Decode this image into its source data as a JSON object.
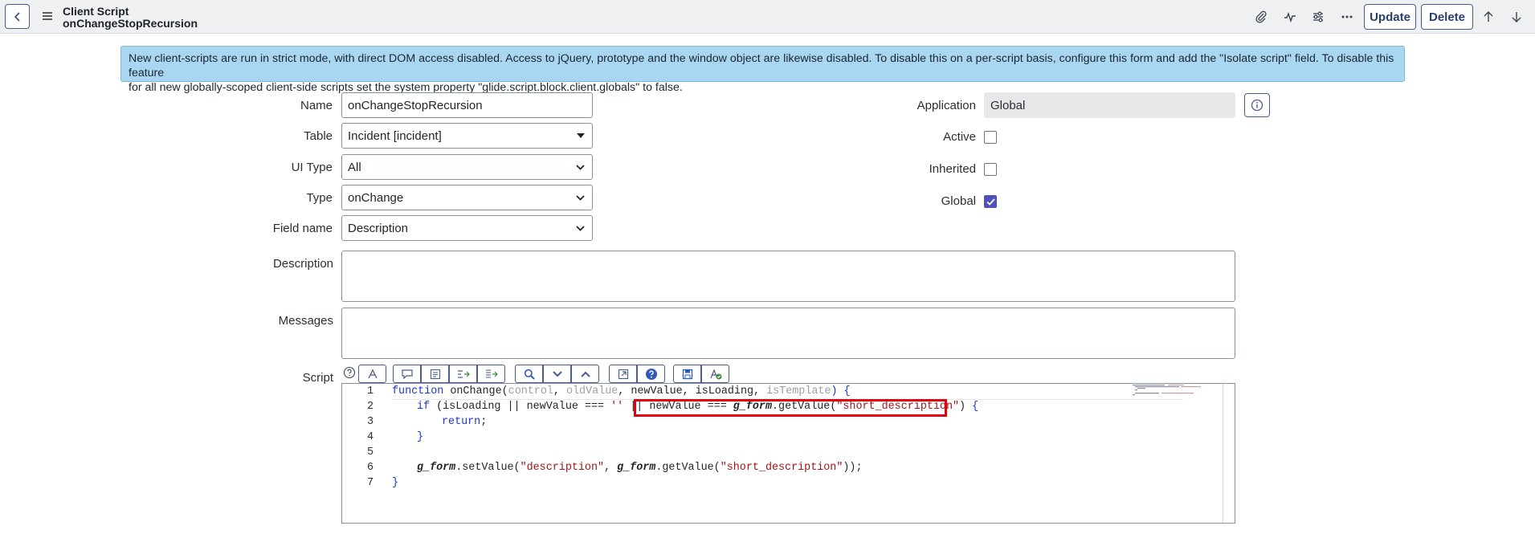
{
  "header": {
    "record_type": "Client Script",
    "record_name": "onChangeStopRecursion",
    "update_label": "Update",
    "delete_label": "Delete"
  },
  "banner": {
    "line1": "New client-scripts are run in strict mode, with direct DOM access disabled. Access to jQuery, prototype and the window object are likewise disabled. To disable this on a per-script basis, configure this form and add the \"Isolate script\" field. To disable this feature",
    "line2": "for all new globally-scoped client-side scripts set the system property \"glide.script.block.client.globals\" to false."
  },
  "form": {
    "name": {
      "label": "Name",
      "value": "onChangeStopRecursion"
    },
    "table": {
      "label": "Table",
      "value": "Incident [incident]"
    },
    "ui_type": {
      "label": "UI Type",
      "value": "All"
    },
    "type": {
      "label": "Type",
      "value": "onChange"
    },
    "field_name": {
      "label": "Field name",
      "value": "Description"
    },
    "application": {
      "label": "Application",
      "value": "Global"
    },
    "active": {
      "label": "Active",
      "checked": false
    },
    "inherited": {
      "label": "Inherited",
      "checked": false
    },
    "global": {
      "label": "Global",
      "checked": true
    },
    "description": {
      "label": "Description",
      "value": ""
    },
    "messages": {
      "label": "Messages",
      "value": ""
    },
    "script": {
      "label": "Script"
    }
  },
  "editor": {
    "line_numbers": [
      "1",
      "2",
      "3",
      "4",
      "5",
      "6",
      "7"
    ],
    "lines": {
      "l1": {
        "kw": "function",
        "fn": " onChange(",
        "p1": "control",
        "c1": ", ",
        "p2": "oldValue",
        "c2": ", newValue, isLoading, ",
        "p3": "isTemplate",
        "end": ") {"
      },
      "l2": {
        "kw": "if",
        "a": " (isLoading || newValue === ",
        "s1": "''",
        "b": " || ",
        "c": "newValue === ",
        "g": "g_form",
        "d": ".getValue(",
        "s2": "\"short_description\"",
        "e": ")",
        "f": " {"
      },
      "l3": {
        "kw": "return",
        "a": ";"
      },
      "l4": {
        "a": "}"
      },
      "l6": {
        "g1": "g_form",
        "a": ".setValue(",
        "s1": "\"description\"",
        "b": ", ",
        "g2": "g_form",
        "c": ".getValue(",
        "s2": "\"short_description\"",
        "d": "));"
      },
      "l7": {
        "a": "}"
      }
    }
  },
  "colors": {
    "banner_bg": "#a9d6f0",
    "accent_button_border": "#4a5b8c",
    "checkbox_checked": "#4f52bd",
    "highlight_box": "#e3000f"
  }
}
